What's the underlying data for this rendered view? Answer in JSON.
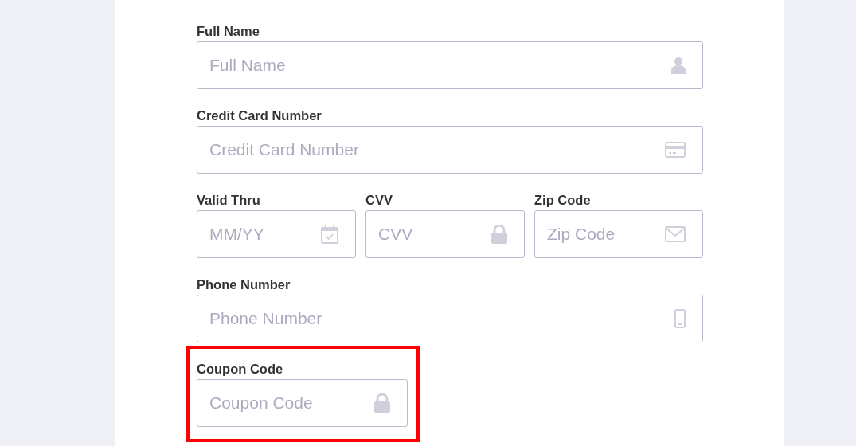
{
  "rows": [
    {
      "fields": [
        {
          "label": "Full Name",
          "placeholder": "Full Name",
          "highlighted": false
        }
      ]
    },
    {
      "fields": [
        {
          "label": "Credit Card Number",
          "placeholder": "Credit Card Number",
          "highlighted": false
        }
      ]
    },
    {
      "fields": [
        {
          "label": "Valid Thru",
          "placeholder": "MM/YY",
          "highlighted": false
        },
        {
          "label": "CVV",
          "placeholder": "CVV",
          "highlighted": false
        },
        {
          "label": "Zip Code",
          "placeholder": "Zip Code",
          "highlighted": false
        }
      ]
    },
    {
      "fields": [
        {
          "label": "Phone Number",
          "placeholder": "Phone Number",
          "highlighted": false
        }
      ]
    },
    {
      "fields": [
        {
          "label": "Coupon Code",
          "placeholder": "Coupon Code",
          "highlighted": true
        }
      ]
    }
  ]
}
